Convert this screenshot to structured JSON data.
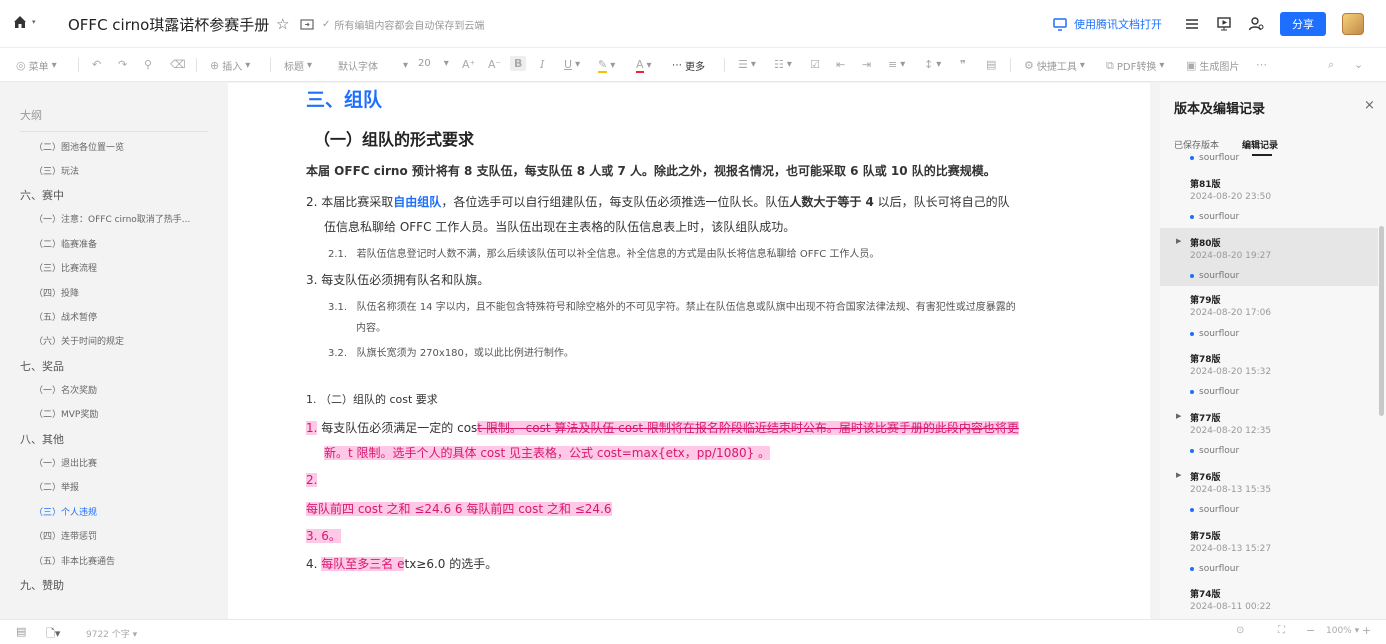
{
  "header": {
    "doc_title": "OFFC cirno琪露诺杯参赛手册",
    "autosave": "所有编辑内容都会自动保存到云端",
    "open_tencent": "使用腾讯文档打开",
    "share": "分享"
  },
  "toolbar": {
    "menu": "菜单",
    "insert": "插入",
    "heading": "标题",
    "font": "默认字体",
    "size": "20",
    "more": "更多",
    "quick_tools": "快捷工具",
    "pdf": "PDF转换",
    "gen_image": "生成图片"
  },
  "outline": {
    "title": "大纲",
    "items": [
      {
        "label": "（二）图池各位置一览",
        "level": 2
      },
      {
        "label": "（三）玩法",
        "level": 2
      },
      {
        "label": "六、赛中",
        "level": 1
      },
      {
        "label": "（一）注意：OFFC cirno取消了热手...",
        "level": 2
      },
      {
        "label": "（二）临赛准备",
        "level": 2
      },
      {
        "label": "（三）比赛流程",
        "level": 2
      },
      {
        "label": "（四）投降",
        "level": 2
      },
      {
        "label": "（五）战术暂停",
        "level": 2
      },
      {
        "label": "（六）关于时间的规定",
        "level": 2
      },
      {
        "label": "七、奖品",
        "level": 1
      },
      {
        "label": "（一）名次奖励",
        "level": 2
      },
      {
        "label": "（二）MVP奖励",
        "level": 2
      },
      {
        "label": "八、其他",
        "level": 1
      },
      {
        "label": "（一）退出比赛",
        "level": 2
      },
      {
        "label": "（二）举报",
        "level": 2
      },
      {
        "label": "（三）个人违规",
        "level": 2,
        "active": true
      },
      {
        "label": "（四）连带惩罚",
        "level": 2
      },
      {
        "label": "（五）非本比赛通告",
        "level": 2
      },
      {
        "label": "九、赞助",
        "level": 1
      }
    ]
  },
  "doc": {
    "h1": "三、组队",
    "h2": "（一）组队的形式要求",
    "p1": "本届 OFFC cirno 预计将有 8 支队伍，每支队伍 8 人或 7 人。除此之外，视报名情况，也可能采取 6 队或 10 队的比赛规模。",
    "l2_num": "2.",
    "l2_a": "本届比赛采取",
    "l2_link": "自由组队",
    "l2_b": "，各位选手可以自行组建队伍，每支队伍必须推选一位队长。队伍",
    "l2_bold": "人数大于等于 4",
    "l2_c": " 以后，队长可将自己的队",
    "l2_line2": "伍信息私聊给 OFFC 工作人员。当队伍出现在主表格的队伍信息表上时，该队组队成功。",
    "l21_num": "2.1.",
    "l21": "若队伍信息登记时人数不满，那么后续该队伍可以补全信息。补全信息的方式是由队长将信息私聊给 OFFC 工作人员。",
    "l3_num": "3.",
    "l3": "每支队伍必须拥有队名和队旗。",
    "l31_num": "3.1.",
    "l31": "队伍名称须在 14 字以内，且不能包含特殊符号和除空格外的不可见字符。禁止在队伍信息或队旗中出现不符合国家法律法规、有害犯性或过度暴露的",
    "l31_line2": "内容。",
    "l32_num": "3.2.",
    "l32": "队旗长宽须为 270x180，或以此比例进行制作。",
    "c1": "1.  （二）组队的 cost 要求",
    "r1_num": "1.",
    "r1_a": "每支队伍必须满足一定的 cos",
    "r1_strike": "t 限制。 cost 算法及队伍 cost 限制将在报名阶段临近结束时公布。届时该比赛手册的此段内容也将更",
    "r1_line2": "新。t 限制。选手个人的具体 cost 见主表格，公式 cost=max{etx，pp/1080} 。",
    "r2": "2.",
    "r3": "每队前四 cost 之和 ≤24.6 6 每队前四 cost 之和 ≤24.6",
    "r4": "3.  6。",
    "r5_num": "4.",
    "r5_hl": "每队至多三名 e",
    "r5_rest": "tx≥6.0 的选手。"
  },
  "panel": {
    "title": "版本及编辑记录",
    "close": "×",
    "tab_saved": "已保存版本",
    "tab_history": "编辑记录",
    "top_user": "sourflour",
    "versions": [
      {
        "title": "第81版",
        "date": "2024-08-20 23:50",
        "user": "sourflour",
        "has_arrow": false
      },
      {
        "title": "第80版",
        "date": "2024-08-20 19:27",
        "user": "sourflour",
        "has_arrow": true,
        "selected": true
      },
      {
        "title": "第79版",
        "date": "2024-08-20 17:06",
        "user": "sourflour",
        "has_arrow": false
      },
      {
        "title": "第78版",
        "date": "2024-08-20 15:32",
        "user": "sourflour",
        "has_arrow": false
      },
      {
        "title": "第77版",
        "date": "2024-08-20 12:35",
        "user": "sourflour",
        "has_arrow": true
      },
      {
        "title": "第76版",
        "date": "2024-08-13 15:35",
        "user": "sourflour",
        "has_arrow": true
      },
      {
        "title": "第75版",
        "date": "2024-08-13 15:27",
        "user": "sourflour",
        "has_arrow": false
      },
      {
        "title": "第74版",
        "date": "2024-08-11 00:22",
        "user": "",
        "has_arrow": false
      }
    ]
  },
  "footer": {
    "wordcount": "9722 个字",
    "zoom": "100%"
  }
}
